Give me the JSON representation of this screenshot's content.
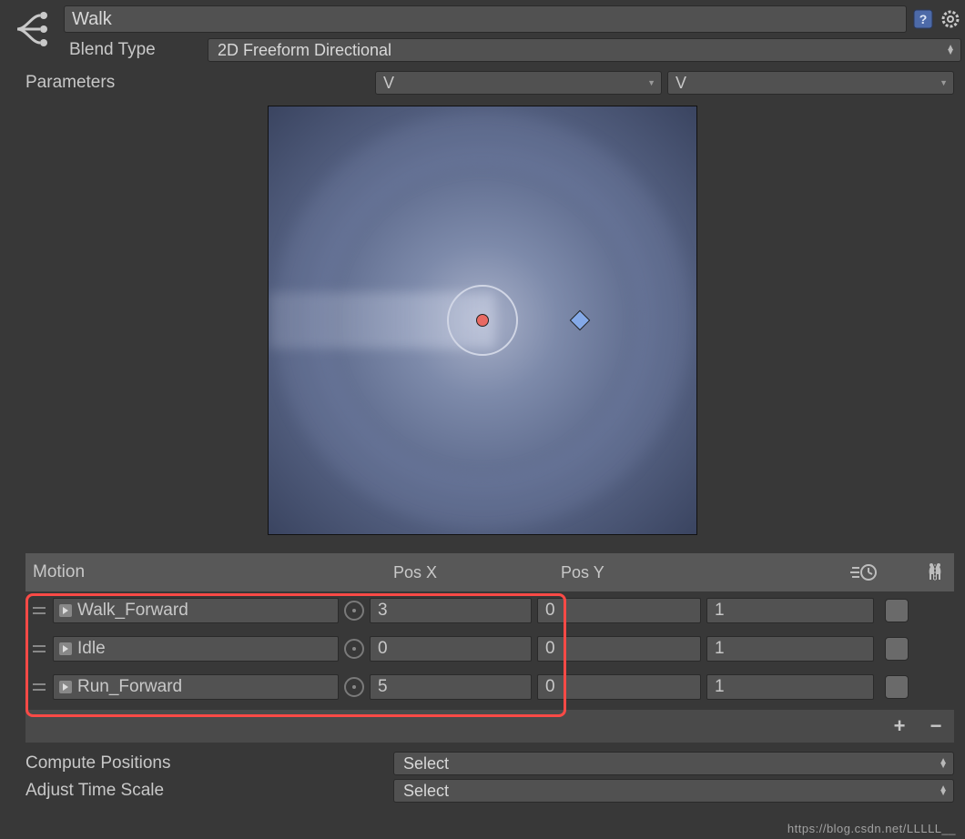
{
  "header": {
    "name": "Walk",
    "blend_type_label": "Blend Type",
    "blend_type_value": "2D Freeform Directional"
  },
  "parameters": {
    "label": "Parameters",
    "param1": "V",
    "param2": "V"
  },
  "table": {
    "head_motion": "Motion",
    "head_posx": "Pos X",
    "head_posy": "Pos Y"
  },
  "motions": [
    {
      "name": "Walk_Forward",
      "posx": "3",
      "posy": "0",
      "speed": "1"
    },
    {
      "name": "Idle",
      "posx": "0",
      "posy": "0",
      "speed": "1"
    },
    {
      "name": "Run_Forward",
      "posx": "5",
      "posy": "0",
      "speed": "1"
    }
  ],
  "footer": {
    "compute_label": "Compute Positions",
    "compute_value": "Select",
    "adjust_label": "Adjust Time Scale",
    "adjust_value": "Select"
  },
  "watermark": "https://blog.csdn.net/LLLLL__"
}
